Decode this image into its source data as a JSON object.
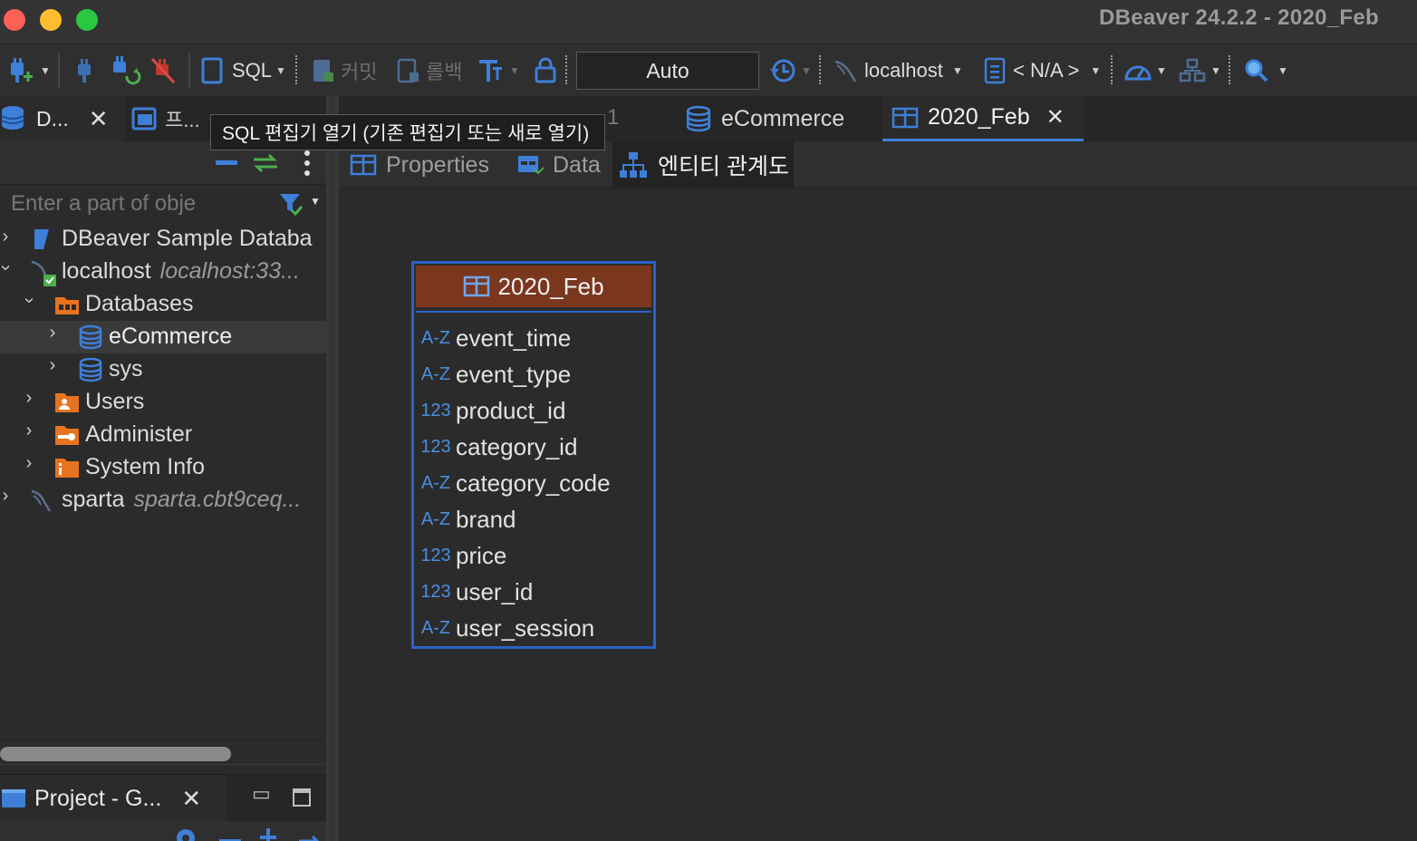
{
  "window": {
    "title": "DBeaver 24.2.2 - 2020_Feb"
  },
  "toolbar": {
    "sql_label": "SQL",
    "commit_label": "커밋",
    "rollback_label": "롤백",
    "transaction_mode": "Auto",
    "connection": "localhost",
    "schema": "< N/A >"
  },
  "left_panel": {
    "tab_navigator": "D...",
    "tab_projects": "프...",
    "filter_placeholder": "Enter a part of obje",
    "tree": [
      {
        "label": "DBeaver Sample Databa",
        "sub": ""
      },
      {
        "label": "localhost",
        "sub": "localhost:33..."
      },
      {
        "label": "Databases",
        "sub": ""
      },
      {
        "label": "eCommerce",
        "sub": ""
      },
      {
        "label": "sys",
        "sub": ""
      },
      {
        "label": "Users",
        "sub": ""
      },
      {
        "label": "Administer",
        "sub": ""
      },
      {
        "label": "System Info",
        "sub": ""
      },
      {
        "label": "sparta",
        "sub": "sparta.cbt9ceq..."
      }
    ],
    "project_tab": "Project - G..."
  },
  "tooltip": {
    "text": "SQL 편집기 열기 (기존 편집기 또는 새로 열기)"
  },
  "editor": {
    "ghost_tab_suffix": "1",
    "tabs": [
      {
        "label": "eCommerce"
      },
      {
        "label": "2020_Feb"
      }
    ],
    "sub_tabs": [
      {
        "label": "Properties"
      },
      {
        "label": "Data"
      },
      {
        "label": "엔티티 관계도"
      }
    ]
  },
  "entity": {
    "name": "2020_Feb",
    "columns": [
      {
        "type": "A-Z",
        "name": "event_time"
      },
      {
        "type": "A-Z",
        "name": "event_type"
      },
      {
        "type": "123",
        "name": "product_id"
      },
      {
        "type": "123",
        "name": "category_id"
      },
      {
        "type": "A-Z",
        "name": "category_code"
      },
      {
        "type": "A-Z",
        "name": "brand"
      },
      {
        "type": "123",
        "name": "price"
      },
      {
        "type": "123",
        "name": "user_id"
      },
      {
        "type": "A-Z",
        "name": "user_session"
      }
    ]
  },
  "colors": {
    "accent": "#2a62c9",
    "entity_header": "#7b361e",
    "type_blue": "#4a8fe0",
    "folder_orange": "#e8731e"
  }
}
